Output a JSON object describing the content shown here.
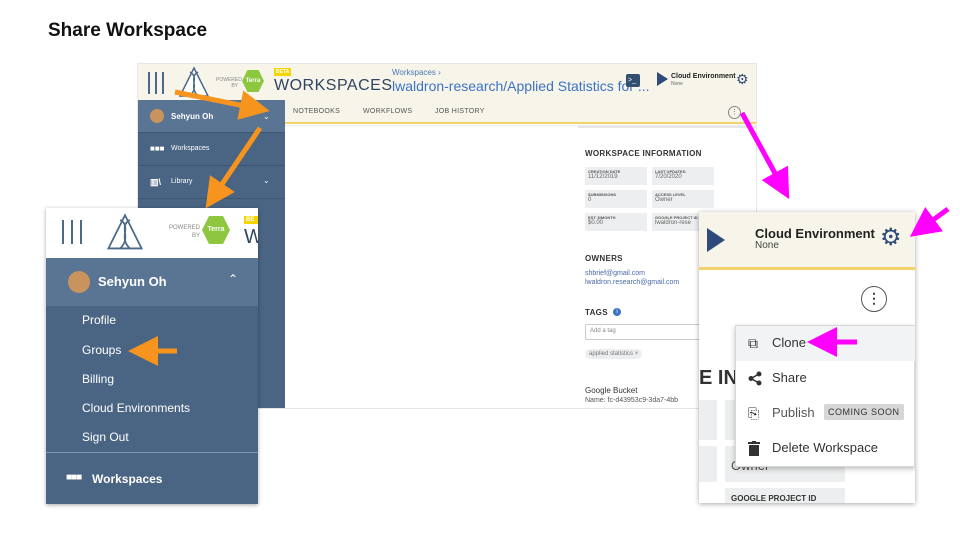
{
  "slide_title": "Share Workspace",
  "header": {
    "powered_by": "POWERED BY",
    "terra": "Terra",
    "beta": "BETA",
    "app_title": "WORKSPACES",
    "breadcrumb_parent": "Workspaces ›",
    "breadcrumb_current": "lwaldron-research/Applied Statistics for ...",
    "cloud_env_title": "Cloud Environment",
    "cloud_env_status": "None"
  },
  "sidebar": {
    "user_name": "Sehyun Oh",
    "items": [
      "Workspaces",
      "Library"
    ]
  },
  "tabs": [
    "NOTEBOOKS",
    "WORKFLOWS",
    "JOB HISTORY"
  ],
  "info_panel": {
    "heading": "WORKSPACE INFORMATION",
    "cells": [
      {
        "label": "CREATION DATE",
        "value": "11/12/2019"
      },
      {
        "label": "LAST UPDATED",
        "value": "7/20/2020"
      },
      {
        "label": "SUBMISSIONS",
        "value": "0"
      },
      {
        "label": "ACCESS LEVEL",
        "value": "Owner"
      },
      {
        "label": "EST. $/MONTH",
        "value": "$0.00"
      },
      {
        "label": "GOOGLE PROJECT ID",
        "value": "lwaldron-rese"
      }
    ],
    "owners_heading": "OWNERS",
    "owners": [
      "shbrief@gmail.com",
      "lwaldron.research@gmail.com"
    ],
    "tags_heading": "TAGS",
    "tag_placeholder": "Add a tag",
    "tag_chip": "applied statistics ×",
    "bucket_heading": "Google Bucket",
    "bucket_name": "Name:  fc-d43953c9-3da7-4bb"
  },
  "left_zoom": {
    "powered_by": "POWERED BY",
    "terra": "Terra",
    "beta": "BE",
    "title_fragment": "W",
    "user_name": "Sehyun Oh",
    "menu": [
      "Profile",
      "Groups",
      "Billing",
      "Cloud Environments",
      "Sign Out"
    ],
    "workspaces": "Workspaces"
  },
  "right_zoom": {
    "cloud_env_title": "Cloud Environment",
    "cloud_env_status": "None",
    "bg_fragment": "E INF",
    "bg_owner": "Owner",
    "bg_google": "GOOGLE PROJECT ID",
    "menu": {
      "clone": "Clone",
      "share": "Share",
      "publish": "Publish",
      "coming_soon": "COMING SOON",
      "delete": "Delete Workspace"
    }
  },
  "colors": {
    "annotation_orange": "#f7941d",
    "annotation_magenta": "#ff00ff",
    "sidebar": "#4a6583",
    "header_bg": "#f7f4ea"
  }
}
